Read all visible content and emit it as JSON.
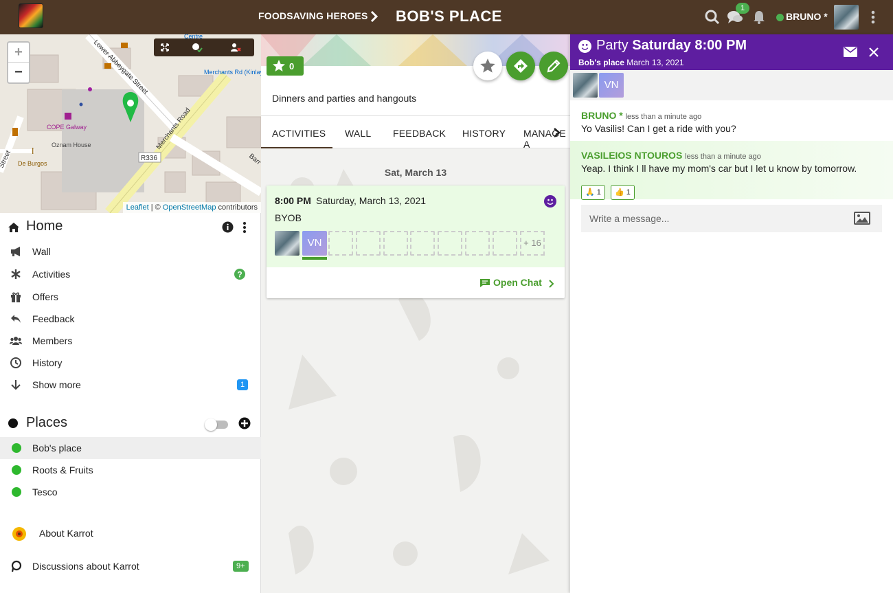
{
  "header": {
    "group": "FOODSAVING HEROES",
    "place": "BOB'S PLACE",
    "chat_count": "1",
    "user": "BRUNO *"
  },
  "map": {
    "attribution_leaflet": "Leaflet",
    "attribution_sep": "| ©",
    "attribution_osm": "OpenStreetMap",
    "attribution_suffix": "contributors",
    "zoom_in": "+",
    "zoom_out": "−",
    "labels": {
      "lower_abbeygate": "Lower Abbeygate Street",
      "merchants_road": "Merchants Road",
      "merchants_rd_kinlay": "Merchants Rd (Kinlay House)",
      "cope": "COPE Galway",
      "oznam": "Oznam House",
      "de_burgos": "De Burgos",
      "r336": "R336",
      "street": "Street",
      "barr": "Barr",
      "centre": "Centre"
    }
  },
  "sidebar": {
    "home_title": "Home",
    "home_items": [
      {
        "label": "Wall"
      },
      {
        "label": "Activities"
      },
      {
        "label": "Offers"
      },
      {
        "label": "Feedback"
      },
      {
        "label": "Members"
      },
      {
        "label": "History"
      },
      {
        "label": "Show more",
        "badge": "1"
      }
    ],
    "places_title": "Places",
    "places": [
      {
        "label": "Bob's place"
      },
      {
        "label": "Roots & Fruits"
      },
      {
        "label": "Tesco"
      }
    ],
    "about": "About Karrot",
    "discussions": "Discussions about Karrot",
    "discussions_badge": "9+"
  },
  "place": {
    "stars": "0",
    "description": "Dinners and parties and hangouts",
    "tabs": [
      "ACTIVITIES",
      "WALL",
      "FEEDBACK",
      "HISTORY",
      "MANAGE A"
    ],
    "date_heading": "Sat, March 13",
    "activity": {
      "time": "8:00 PM",
      "date": "Saturday, March 13, 2021",
      "note": "BYOB",
      "participant_initials": "VN",
      "more": "+ 16",
      "open_chat": "Open Chat"
    }
  },
  "chat": {
    "title_prefix": "Party",
    "title_bold": "Saturday 8:00 PM",
    "sub_place": "Bob's place",
    "sub_date": "March 13, 2021",
    "participant_initials": "VN",
    "messages": [
      {
        "author": "BRUNO *",
        "time": "less than a minute ago",
        "text": "Yo Vasilis! Can I get a ride with you?"
      },
      {
        "author": "VASILEIOS NTOUROS",
        "time": "less than a minute ago",
        "text": "Yeap. I think I ll have my mom's car but I let u know by tomorrow.",
        "reactions": [
          {
            "emoji": "🙏",
            "count": "1"
          },
          {
            "emoji": "👍",
            "count": "1"
          }
        ]
      }
    ],
    "placeholder": "Write a message..."
  },
  "colors": {
    "topbar": "#4e3826",
    "chat_header": "#5e1ea0",
    "accent_green": "#4a9e2e",
    "place_dot": "#2eb82e"
  }
}
